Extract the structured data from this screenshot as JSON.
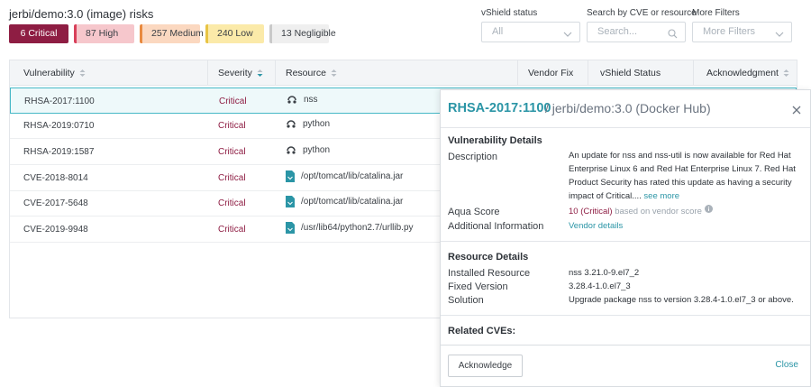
{
  "page": {
    "title": "jerbi/demo:3.0 (image) risks",
    "badges": [
      {
        "label": "6 Critical",
        "kind": "critical"
      },
      {
        "label": "87 High",
        "kind": "high"
      },
      {
        "label": "257 Medium",
        "kind": "medium"
      },
      {
        "label": "240 Low",
        "kind": "low"
      },
      {
        "label": "13 Negligible",
        "kind": "negligible"
      }
    ],
    "colors": {
      "critical": "#8e1d43",
      "accent": "#2b95a6",
      "high": "#d8405a",
      "medium": "#e88a3f",
      "low": "#e8c445"
    }
  },
  "filters": {
    "vshield_label": "vShield status",
    "vshield_value": "All",
    "search_label": "Search by CVE or resource",
    "search_placeholder": "Search...",
    "more_label": "More Filters",
    "more_value": "More Filters"
  },
  "table": {
    "headers": {
      "vulnerability": "Vulnerability",
      "severity": "Severity",
      "resource": "Resource",
      "vendor_fix": "Vendor Fix",
      "vshield_status": "vShield Status",
      "acknowledgment": "Acknowledgment"
    },
    "rows": [
      {
        "vuln": "RHSA-2017:1100",
        "severity": "Critical",
        "resource": "nss",
        "icon": "package-icon"
      },
      {
        "vuln": "RHSA-2019:0710",
        "severity": "Critical",
        "resource": "python",
        "icon": "package-icon"
      },
      {
        "vuln": "RHSA-2019:1587",
        "severity": "Critical",
        "resource": "python",
        "icon": "package-icon"
      },
      {
        "vuln": "CVE-2018-8014",
        "severity": "Critical",
        "resource": "/opt/tomcat/lib/catalina.jar",
        "icon": "file-icon"
      },
      {
        "vuln": "CVE-2017-5648",
        "severity": "Critical",
        "resource": "/opt/tomcat/lib/catalina.jar",
        "icon": "file-icon"
      },
      {
        "vuln": "CVE-2019-9948",
        "severity": "Critical",
        "resource": "/usr/lib64/python2.7/urllib.py",
        "icon": "file-icon"
      }
    ]
  },
  "panel": {
    "id": "RHSA-2017:1100",
    "subtitle": "/ jerbi/demo:3.0 (Docker Hub)",
    "vuln_details_title": "Vulnerability Details",
    "description_label": "Description",
    "description_text": "An update for nss and nss-util is now available for Red Hat Enterprise Linux 6 and Red Hat Enterprise Linux 7. Red Hat Product Security has rated this update as having a security impact of Critical....",
    "see_more": "see more",
    "aqua_score_label": "Aqua Score",
    "aqua_score_value": "10 (Critical)",
    "aqua_score_note": "based on vendor score",
    "additional_info_label": "Additional Information",
    "vendor_details": "Vendor details",
    "resource_details_title": "Resource Details",
    "installed_label": "Installed Resource",
    "installed_value": "nss 3.21.0-9.el7_2",
    "fixed_label": "Fixed Version",
    "fixed_value": "3.28.4-1.0.el7_3",
    "solution_label": "Solution",
    "solution_value": "Upgrade package nss to version 3.28.4-1.0.el7_3 or above.",
    "related_title": "Related CVEs:",
    "acknowledge_button": "Acknowledge",
    "close_link": "Close"
  }
}
